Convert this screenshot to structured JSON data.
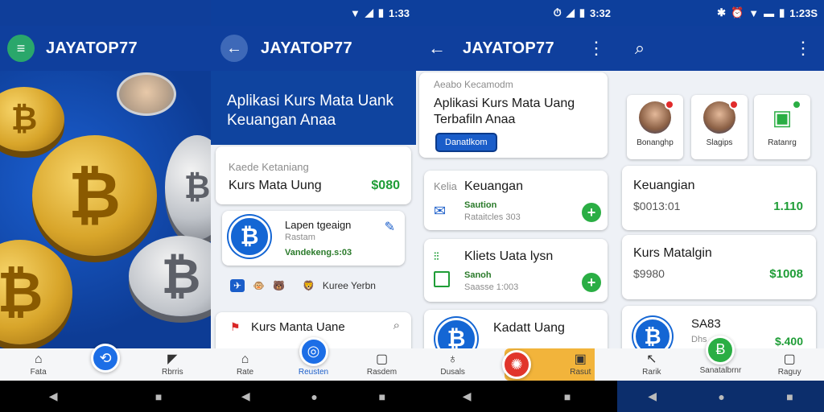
{
  "colors": {
    "primary": "#0f3f9d",
    "accent_green": "#1f9d37",
    "fab_blue": "#1c6ee6"
  },
  "p1": {
    "status_clock": "",
    "app_title": "JAYATOP77",
    "nav": {
      "home": "Fata",
      "center": "",
      "right": "Rbrris"
    }
  },
  "p2": {
    "status_clock": "1:33",
    "app_title": "JAYATOP77",
    "hero_line1": "Aplikasi Kurs Mata Uank",
    "hero_line2": "Keuangan Anaa",
    "card1": {
      "sub": "Kaede Ketaniang",
      "title": "Kurs Mata Uung",
      "value": "$080"
    },
    "card2": {
      "title": "Lapen tgeaign",
      "sub": "Rastam",
      "green": "Vandekeng.s:03"
    },
    "card3": {
      "title": "Kurs Manta Uane"
    },
    "emoji_row": "Kuree Yerbn",
    "nav": {
      "left": "Rate",
      "center": "Reusten",
      "right": "Rasdem"
    }
  },
  "p3": {
    "status_clock": "3:32",
    "app_title": "JAYATOP77",
    "card1": {
      "sub": "Aeabo Kecamodm",
      "title1": "Aplikasi Kurs Mata Uang",
      "title2": "Terbafiln Anaa",
      "button": "Danatlkom"
    },
    "card2": {
      "icon_label": "Kelia",
      "title": "Keuangan",
      "green": "Saution",
      "sub": "Rataitcles 303"
    },
    "card3": {
      "icon_label": "Kliets Uata lysn",
      "green": "Sanoh",
      "sub": "Saasse 1:003"
    },
    "card4": {
      "title": "Kadatt Uang"
    },
    "nav": {
      "left": "Dusals",
      "right": "Rasut"
    }
  },
  "p4": {
    "status_clock": "1:23S",
    "avatars": [
      "Bonanghp",
      "Slagips",
      "Ratanrg"
    ],
    "card1": {
      "title": "Keuangian",
      "sub": "$0013:01",
      "value": "1.110"
    },
    "card2": {
      "title": "Kurs Matalgin",
      "sub": "$9980",
      "value": "$1008"
    },
    "card3": {
      "title": "SA83",
      "sub": "Dhs",
      "value": "$.400"
    },
    "nav": {
      "left": "Rarik",
      "center": "Sanatalbrnr",
      "right": "Raguy"
    }
  }
}
